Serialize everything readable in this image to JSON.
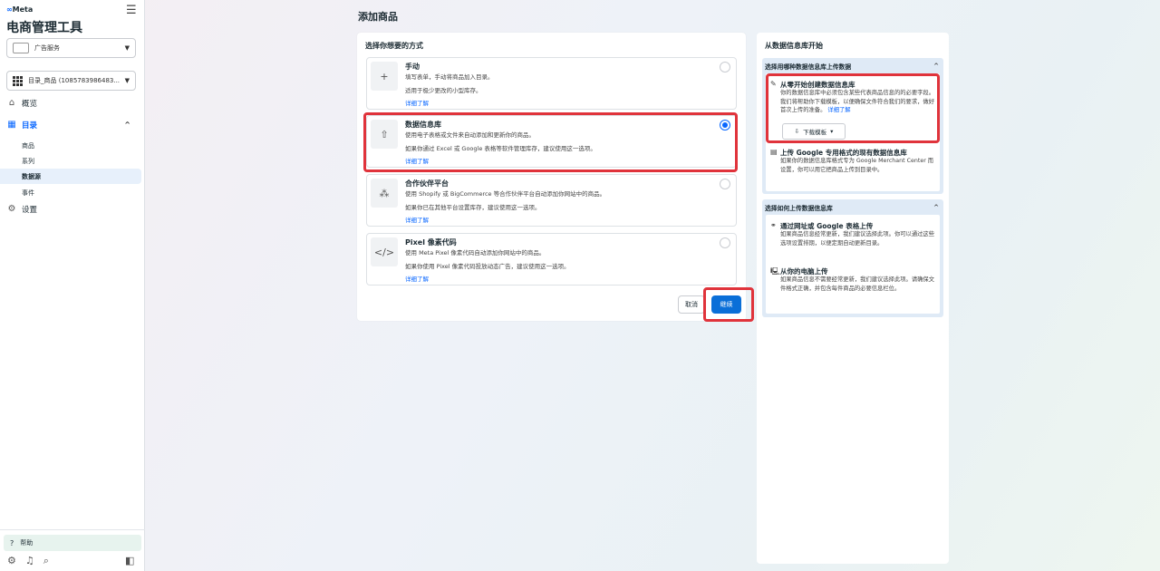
{
  "sidebar": {
    "brand": "Meta",
    "app_title": "电商管理工具",
    "business_selector": "广告服务",
    "catalog_selector": "目录_商品 (1085783986483...",
    "nav": {
      "overview": "概览",
      "catalog": "目录",
      "settings": "设置"
    },
    "sub_items": [
      "商品",
      "系列",
      "数据源",
      "事件"
    ],
    "help": "帮助"
  },
  "main": {
    "page_title": "添加商品",
    "card_title": "选择你想要的方式",
    "options": [
      {
        "title": "手动",
        "desc": "填写表单，手动将商品加入目录。",
        "note": "适用于极少更改的小型库存。",
        "link": "详细了解",
        "selected": false
      },
      {
        "title": "数据信息库",
        "desc": "使用电子表格或文件来自动添加和更新你的商品。",
        "note": "如果你通过 Excel 或 Google 表格等软件管理库存，建议使用这一选项。",
        "link": "详细了解",
        "selected": true
      },
      {
        "title": "合作伙伴平台",
        "desc": "使用 Shopify 或 BigCommerce 等合作伙伴平台自动添加你网站中的商品。",
        "note": "如果你已在其他平台设置库存，建议使用这一选项。",
        "link": "详细了解",
        "selected": false
      },
      {
        "title": "Pixel 像素代码",
        "desc": "使用 Meta Pixel 像素代码自动添加你网站中的商品。",
        "note": "如果你使用 Pixel 像素代码投放动态广告，建议使用这一选项。",
        "link": "详细了解",
        "selected": false
      }
    ],
    "cancel_label": "取消",
    "continue_label": "继续"
  },
  "side": {
    "title": "从数据信息库开始",
    "section1": {
      "heading": "选择用哪种数据信息库上传数据",
      "item1_title": "从零开始创建数据信息库",
      "item1_desc": "你的数据信息库中必须包含某些代表商品信息的的必要字段。我们将帮助你下载模板，以便确保文件符合我们的要求，做好首次上传的准备。",
      "item1_link": "详细了解",
      "download_label": "下载模板",
      "item2_title": "上传 Google 专用格式的现有数据信息库",
      "item2_desc": "如果你的数据信息库格式专为 Google Merchant Center 而设置，你可以用它把商品上传到目录中。"
    },
    "section2": {
      "heading": "选择如何上传数据信息库",
      "item1_title": "通过网址或 Google 表格上传",
      "item1_desc": "如果商品信息经常更新，我们建议选择此项。你可以通过这些选项设置排期，以便定期自动更新目录。",
      "item2_title": "从你的电脑上传",
      "item2_desc": "如果商品信息不需要经常更新，我们建议选择此项。请确保文件格式正确，并包含每件商品的必要信息栏位。"
    }
  },
  "colors": {
    "accent": "#0866ff",
    "highlight": "#e0333b",
    "primary_button": "#0a6fd8"
  }
}
